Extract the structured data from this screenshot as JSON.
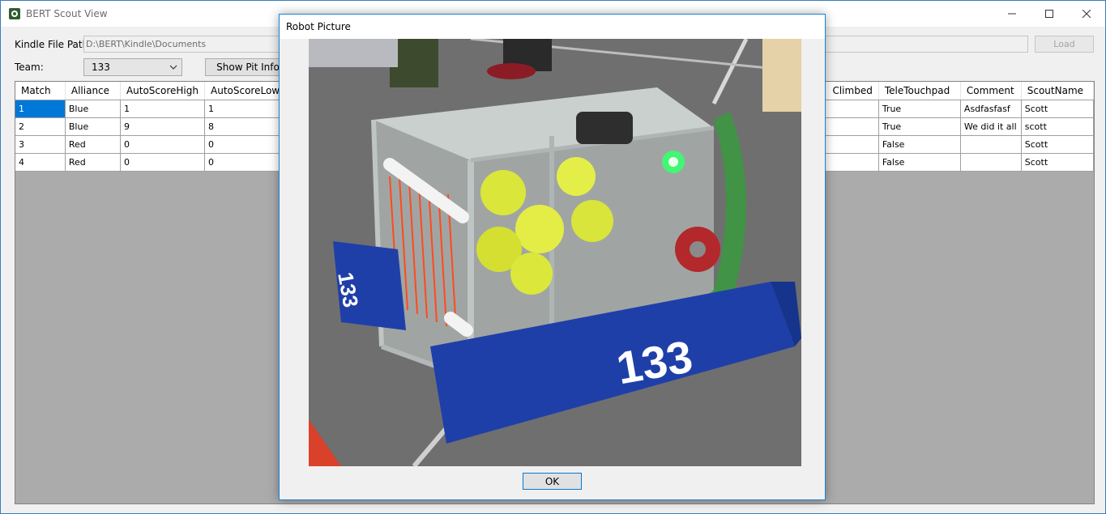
{
  "window": {
    "title": "BERT Scout View"
  },
  "form": {
    "kindle_label": "Kindle File Path:",
    "kindle_path": "D:\\BERT\\Kindle\\Documents",
    "load_label": "Load",
    "team_label": "Team:",
    "team_value": "133",
    "pit_label": "Show Pit Info"
  },
  "grid": {
    "columns": [
      "Match",
      "Alliance",
      "AutoScoreHigh",
      "AutoScoreLow",
      "Climbed",
      "TeleTouchpad",
      "Comment",
      "ScoutName"
    ],
    "rows": [
      {
        "match": "1",
        "alliance": "Blue",
        "high": "1",
        "low": "1",
        "touchpad": "True",
        "comment": "Asdfasfasf",
        "scout": "Scott"
      },
      {
        "match": "2",
        "alliance": "Blue",
        "high": "9",
        "low": "8",
        "touchpad": "True",
        "comment": "We did it all",
        "scout": "scott"
      },
      {
        "match": "3",
        "alliance": "Red",
        "high": "0",
        "low": "0",
        "touchpad": "False",
        "comment": "",
        "scout": "Scott"
      },
      {
        "match": "4",
        "alliance": "Red",
        "high": "0",
        "low": "0",
        "touchpad": "False",
        "comment": "",
        "scout": "Scott"
      }
    ]
  },
  "dialog": {
    "title": "Robot Picture",
    "ok_label": "OK",
    "photo_number": "133"
  },
  "colors": {
    "accent": "#0078d7",
    "bumper": "#1f3fa8"
  }
}
